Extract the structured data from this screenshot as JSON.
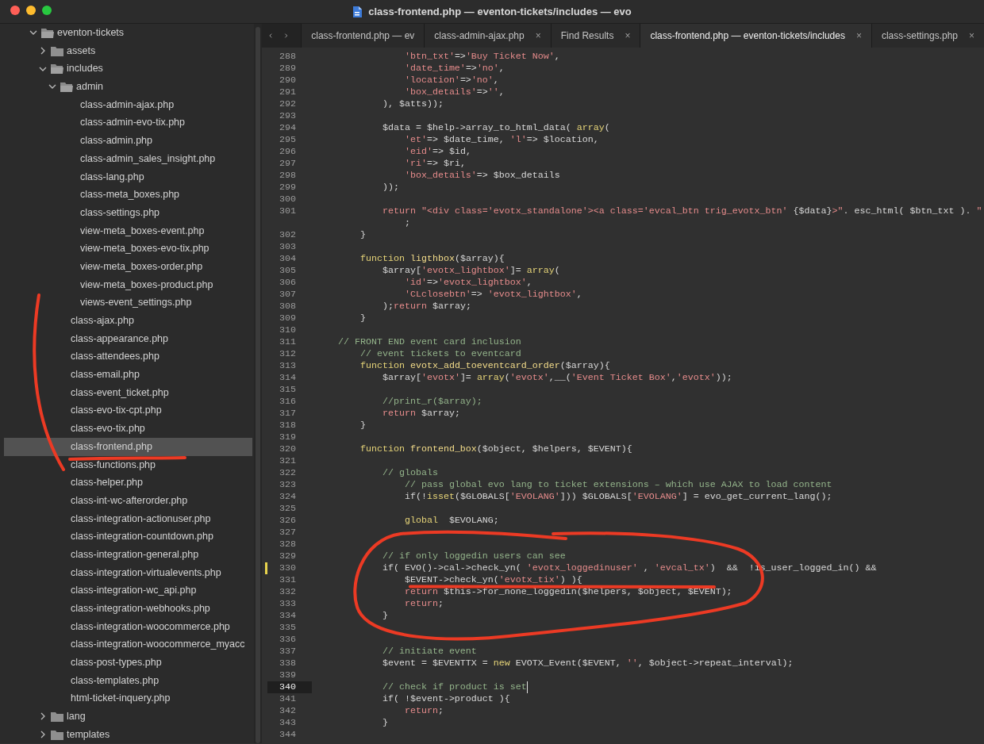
{
  "window": {
    "title": "class-frontend.php — eventon-tickets/includes — evo"
  },
  "sidebar": {
    "items": [
      {
        "name": "eventon-tickets",
        "kind": "folder",
        "expanded": true,
        "selected": false,
        "children": [
          {
            "name": "assets",
            "kind": "folder",
            "expanded": false,
            "selected": false
          },
          {
            "name": "includes",
            "kind": "folder",
            "expanded": true,
            "selected": false,
            "children": [
              {
                "name": "admin",
                "kind": "folder",
                "expanded": true,
                "selected": false,
                "children": [
                  {
                    "name": "class-admin-ajax.php",
                    "kind": "file",
                    "selected": false
                  },
                  {
                    "name": "class-admin-evo-tix.php",
                    "kind": "file",
                    "selected": false
                  },
                  {
                    "name": "class-admin.php",
                    "kind": "file",
                    "selected": false
                  },
                  {
                    "name": "class-admin_sales_insight.php",
                    "kind": "file",
                    "selected": false
                  },
                  {
                    "name": "class-lang.php",
                    "kind": "file",
                    "selected": false
                  },
                  {
                    "name": "class-meta_boxes.php",
                    "kind": "file",
                    "selected": false
                  },
                  {
                    "name": "class-settings.php",
                    "kind": "file",
                    "selected": false
                  },
                  {
                    "name": "view-meta_boxes-event.php",
                    "kind": "file",
                    "selected": false
                  },
                  {
                    "name": "view-meta_boxes-evo-tix.php",
                    "kind": "file",
                    "selected": false
                  },
                  {
                    "name": "view-meta_boxes-order.php",
                    "kind": "file",
                    "selected": false
                  },
                  {
                    "name": "view-meta_boxes-product.php",
                    "kind": "file",
                    "selected": false
                  },
                  {
                    "name": "views-event_settings.php",
                    "kind": "file",
                    "selected": false
                  }
                ]
              },
              {
                "name": "class-ajax.php",
                "kind": "file",
                "selected": false
              },
              {
                "name": "class-appearance.php",
                "kind": "file",
                "selected": false
              },
              {
                "name": "class-attendees.php",
                "kind": "file",
                "selected": false
              },
              {
                "name": "class-email.php",
                "kind": "file",
                "selected": false
              },
              {
                "name": "class-event_ticket.php",
                "kind": "file",
                "selected": false
              },
              {
                "name": "class-evo-tix-cpt.php",
                "kind": "file",
                "selected": false
              },
              {
                "name": "class-evo-tix.php",
                "kind": "file",
                "selected": false
              },
              {
                "name": "class-frontend.php",
                "kind": "file",
                "selected": true
              },
              {
                "name": "class-functions.php",
                "kind": "file",
                "selected": false
              },
              {
                "name": "class-helper.php",
                "kind": "file",
                "selected": false
              },
              {
                "name": "class-int-wc-afterorder.php",
                "kind": "file",
                "selected": false
              },
              {
                "name": "class-integration-actionuser.php",
                "kind": "file",
                "selected": false
              },
              {
                "name": "class-integration-countdown.php",
                "kind": "file",
                "selected": false
              },
              {
                "name": "class-integration-general.php",
                "kind": "file",
                "selected": false
              },
              {
                "name": "class-integration-virtualevents.php",
                "kind": "file",
                "selected": false
              },
              {
                "name": "class-integration-wc_api.php",
                "kind": "file",
                "selected": false
              },
              {
                "name": "class-integration-webhooks.php",
                "kind": "file",
                "selected": false
              },
              {
                "name": "class-integration-woocommerce.php",
                "kind": "file",
                "selected": false
              },
              {
                "name": "class-integration-woocommerce_myacc",
                "kind": "file",
                "selected": false
              },
              {
                "name": "class-post-types.php",
                "kind": "file",
                "selected": false
              },
              {
                "name": "class-templates.php",
                "kind": "file",
                "selected": false
              },
              {
                "name": "html-ticket-inquery.php",
                "kind": "file",
                "selected": false
              }
            ]
          },
          {
            "name": "lang",
            "kind": "folder",
            "expanded": false,
            "selected": false
          },
          {
            "name": "templates",
            "kind": "folder",
            "expanded": false,
            "selected": false
          }
        ]
      }
    ]
  },
  "tabs": [
    {
      "label": "class-frontend.php — ev",
      "selected": false
    },
    {
      "label": "class-admin-ajax.php",
      "selected": false,
      "close": "×"
    },
    {
      "label": "Find Results",
      "selected": false,
      "close": "×"
    },
    {
      "label": "class-frontend.php — eventon-tickets/includes",
      "selected": true,
      "close": "×"
    },
    {
      "label": "class-settings.php",
      "selected": false,
      "close": "×"
    }
  ],
  "editor": {
    "lines": [
      {
        "num": "288",
        "modified": false,
        "current": false,
        "parts": [
          {
            "kind": "str",
            "text": "                'btn_txt'"
          },
          {
            "kind": "plain",
            "text": "=>"
          },
          {
            "kind": "str",
            "text": "'Buy Ticket Now'"
          },
          {
            "kind": "plain",
            "text": ","
          }
        ]
      },
      {
        "num": "289",
        "modified": false,
        "current": false,
        "parts": [
          {
            "kind": "str",
            "text": "                'date_time'"
          },
          {
            "kind": "plain",
            "text": "=>"
          },
          {
            "kind": "str",
            "text": "'no'"
          },
          {
            "kind": "plain",
            "text": ","
          }
        ]
      },
      {
        "num": "290",
        "modified": false,
        "current": false,
        "parts": [
          {
            "kind": "str",
            "text": "                'location'"
          },
          {
            "kind": "plain",
            "text": "=>"
          },
          {
            "kind": "str",
            "text": "'no'"
          },
          {
            "kind": "plain",
            "text": ","
          }
        ]
      },
      {
        "num": "291",
        "modified": false,
        "current": false,
        "parts": [
          {
            "kind": "str",
            "text": "                'box_details'"
          },
          {
            "kind": "plain",
            "text": "=>"
          },
          {
            "kind": "str",
            "text": "''"
          },
          {
            "kind": "plain",
            "text": ","
          }
        ]
      },
      {
        "num": "292",
        "modified": false,
        "current": false,
        "parts": [
          {
            "kind": "plain",
            "text": "            ), $atts));"
          }
        ]
      },
      {
        "num": "293",
        "modified": false,
        "current": false
      },
      {
        "num": "294",
        "modified": false,
        "current": false,
        "parts": [
          {
            "kind": "plain",
            "text": "            $data = $help->array_to_html_data( "
          },
          {
            "kind": "kw",
            "text": "array"
          },
          {
            "kind": "plain",
            "text": "("
          }
        ]
      },
      {
        "num": "295",
        "modified": false,
        "current": false,
        "parts": [
          {
            "kind": "str",
            "text": "                'et'"
          },
          {
            "kind": "plain",
            "text": "=> $date_time, "
          },
          {
            "kind": "str",
            "text": "'l'"
          },
          {
            "kind": "plain",
            "text": "=> $location,"
          }
        ]
      },
      {
        "num": "296",
        "modified": false,
        "current": false,
        "parts": [
          {
            "kind": "str",
            "text": "                'eid'"
          },
          {
            "kind": "plain",
            "text": "=> $id,"
          }
        ]
      },
      {
        "num": "297",
        "modified": false,
        "current": false,
        "parts": [
          {
            "kind": "str",
            "text": "                'ri'"
          },
          {
            "kind": "plain",
            "text": "=> $ri,"
          }
        ]
      },
      {
        "num": "298",
        "modified": false,
        "current": false,
        "parts": [
          {
            "kind": "str",
            "text": "                'box_details'"
          },
          {
            "kind": "plain",
            "text": "=> $box_details"
          }
        ]
      },
      {
        "num": "299",
        "modified": false,
        "current": false,
        "parts": [
          {
            "kind": "plain",
            "text": "            ));"
          }
        ]
      },
      {
        "num": "300",
        "modified": false,
        "current": false
      },
      {
        "num": "301",
        "modified": false,
        "current": false,
        "parts": [
          {
            "kind": "ret",
            "text": "            return"
          },
          {
            "kind": "str",
            "text": " \"<div class='evotx_standalone'><a class='evcal_btn trig_evotx_btn' "
          },
          {
            "kind": "plain",
            "text": "{$data}"
          },
          {
            "kind": "str",
            "text": ">\""
          },
          {
            "kind": "plain",
            "text": ". esc_html( $btn_txt ). "
          },
          {
            "kind": "str",
            "text": "\""
          }
        ]
      },
      {
        "modified": false,
        "current": false,
        "parts": [
          {
            "kind": "plain",
            "text": "                ;"
          }
        ]
      },
      {
        "num": "302",
        "modified": false,
        "current": false,
        "parts": [
          {
            "kind": "plain",
            "text": "        }"
          }
        ]
      },
      {
        "num": "303",
        "modified": false,
        "current": false
      },
      {
        "num": "304",
        "modified": false,
        "current": false,
        "parts": [
          {
            "kind": "kw",
            "text": "        function"
          },
          {
            "kind": "ent",
            "text": " ligthbox"
          },
          {
            "kind": "plain",
            "text": "($array){"
          }
        ]
      },
      {
        "num": "305",
        "modified": false,
        "current": false,
        "parts": [
          {
            "kind": "plain",
            "text": "            $array["
          },
          {
            "kind": "str",
            "text": "'evotx_lightbox'"
          },
          {
            "kind": "plain",
            "text": "]= "
          },
          {
            "kind": "kw",
            "text": "array"
          },
          {
            "kind": "plain",
            "text": "("
          }
        ]
      },
      {
        "num": "306",
        "modified": false,
        "current": false,
        "parts": [
          {
            "kind": "str",
            "text": "                'id'"
          },
          {
            "kind": "plain",
            "text": "=>"
          },
          {
            "kind": "str",
            "text": "'evotx_lightbox'"
          },
          {
            "kind": "plain",
            "text": ","
          }
        ]
      },
      {
        "num": "307",
        "modified": false,
        "current": false,
        "parts": [
          {
            "kind": "str",
            "text": "                'CLclosebtn'"
          },
          {
            "kind": "plain",
            "text": "=> "
          },
          {
            "kind": "str",
            "text": "'evotx_lightbox'"
          },
          {
            "kind": "plain",
            "text": ","
          }
        ]
      },
      {
        "num": "308",
        "modified": false,
        "current": false,
        "parts": [
          {
            "kind": "plain",
            "text": "            );"
          },
          {
            "kind": "ret",
            "text": "return"
          },
          {
            "kind": "plain",
            "text": " $array;"
          }
        ]
      },
      {
        "num": "309",
        "modified": false,
        "current": false,
        "parts": [
          {
            "kind": "plain",
            "text": "        }"
          }
        ]
      },
      {
        "num": "310",
        "modified": false,
        "current": false
      },
      {
        "num": "311",
        "modified": false,
        "current": false,
        "parts": [
          {
            "kind": "cmt",
            "text": "    // FRONT END event card inclusion"
          }
        ]
      },
      {
        "num": "312",
        "modified": false,
        "current": false,
        "parts": [
          {
            "kind": "cmt",
            "text": "        // event tickets to eventcard"
          }
        ]
      },
      {
        "num": "313",
        "modified": false,
        "current": false,
        "parts": [
          {
            "kind": "kw",
            "text": "        function"
          },
          {
            "kind": "ent",
            "text": " evotx_add_toeventcard_order"
          },
          {
            "kind": "plain",
            "text": "($array){"
          }
        ]
      },
      {
        "num": "314",
        "modified": false,
        "current": false,
        "parts": [
          {
            "kind": "plain",
            "text": "            $array["
          },
          {
            "kind": "str",
            "text": "'evotx'"
          },
          {
            "kind": "plain",
            "text": "]= "
          },
          {
            "kind": "kw",
            "text": "array"
          },
          {
            "kind": "plain",
            "text": "("
          },
          {
            "kind": "str",
            "text": "'evotx'"
          },
          {
            "kind": "plain",
            "text": ",__("
          },
          {
            "kind": "str",
            "text": "'Event Ticket Box'"
          },
          {
            "kind": "plain",
            "text": ","
          },
          {
            "kind": "str",
            "text": "'evotx'"
          },
          {
            "kind": "plain",
            "text": "));"
          }
        ]
      },
      {
        "num": "315",
        "modified": false,
        "current": false
      },
      {
        "num": "316",
        "modified": false,
        "current": false,
        "parts": [
          {
            "kind": "cmt",
            "text": "            //print_r($array);"
          }
        ]
      },
      {
        "num": "317",
        "modified": false,
        "current": false,
        "parts": [
          {
            "kind": "ret",
            "text": "            return"
          },
          {
            "kind": "plain",
            "text": " $array;"
          }
        ]
      },
      {
        "num": "318",
        "modified": false,
        "current": false,
        "parts": [
          {
            "kind": "plain",
            "text": "        }"
          }
        ]
      },
      {
        "num": "319",
        "modified": false,
        "current": false
      },
      {
        "num": "320",
        "modified": false,
        "current": false,
        "parts": [
          {
            "kind": "kw",
            "text": "        function"
          },
          {
            "kind": "ent",
            "text": " frontend_box"
          },
          {
            "kind": "plain",
            "text": "($object, $helpers, $EVENT){"
          }
        ]
      },
      {
        "num": "321",
        "modified": false,
        "current": false
      },
      {
        "num": "322",
        "modified": false,
        "current": false,
        "parts": [
          {
            "kind": "cmt",
            "text": "            // globals"
          }
        ]
      },
      {
        "num": "323",
        "modified": false,
        "current": false,
        "parts": [
          {
            "kind": "cmt",
            "text": "                // pass global evo lang to ticket extensions – which use AJAX to load content"
          }
        ]
      },
      {
        "num": "324",
        "modified": false,
        "current": false,
        "parts": [
          {
            "kind": "plain",
            "text": "                if(!"
          },
          {
            "kind": "kw",
            "text": "isset"
          },
          {
            "kind": "plain",
            "text": "($GLOBALS["
          },
          {
            "kind": "str",
            "text": "'EVOLANG'"
          },
          {
            "kind": "plain",
            "text": "])) $GLOBALS["
          },
          {
            "kind": "str",
            "text": "'EVOLANG'"
          },
          {
            "kind": "plain",
            "text": "] = evo_get_current_lang();"
          }
        ]
      },
      {
        "num": "325",
        "modified": false,
        "current": false
      },
      {
        "num": "326",
        "modified": false,
        "current": false,
        "parts": [
          {
            "kind": "kw",
            "text": "                global"
          },
          {
            "kind": "plain",
            "text": "  $EVOLANG;"
          }
        ]
      },
      {
        "num": "327",
        "modified": false,
        "current": false
      },
      {
        "num": "328",
        "modified": false,
        "current": false
      },
      {
        "num": "329",
        "modified": false,
        "current": false,
        "parts": [
          {
            "kind": "cmt",
            "text": "            // if only loggedin users can see"
          }
        ]
      },
      {
        "num": "330",
        "modified": true,
        "current": false,
        "parts": [
          {
            "kind": "plain",
            "text": "            if( EVO()->cal->check_yn( "
          },
          {
            "kind": "str",
            "text": "'evotx_loggedinuser'"
          },
          {
            "kind": "plain",
            "text": " , "
          },
          {
            "kind": "str",
            "text": "'evcal_tx'"
          },
          {
            "kind": "plain",
            "text": ")  &&  !is_user_logged_in() &&"
          }
        ]
      },
      {
        "num": "331",
        "modified": false,
        "current": false,
        "parts": [
          {
            "kind": "plain",
            "text": "                $EVENT->check_yn("
          },
          {
            "kind": "str",
            "text": "'evotx_tix'"
          },
          {
            "kind": "plain",
            "text": ") ){"
          }
        ]
      },
      {
        "num": "332",
        "modified": false,
        "current": false,
        "parts": [
          {
            "kind": "ret",
            "text": "                return"
          },
          {
            "kind": "plain",
            "text": " $this->for_none_loggedin($helpers, $object, $EVENT);"
          }
        ]
      },
      {
        "num": "333",
        "modified": false,
        "current": false,
        "parts": [
          {
            "kind": "ret",
            "text": "                return"
          },
          {
            "kind": "plain",
            "text": ";"
          }
        ]
      },
      {
        "num": "334",
        "modified": false,
        "current": false,
        "parts": [
          {
            "kind": "plain",
            "text": "            }"
          }
        ]
      },
      {
        "num": "335",
        "modified": false,
        "current": false
      },
      {
        "num": "336",
        "modified": false,
        "current": false
      },
      {
        "num": "337",
        "modified": false,
        "current": false,
        "parts": [
          {
            "kind": "cmt",
            "text": "            // initiate event"
          }
        ]
      },
      {
        "num": "338",
        "modified": false,
        "current": false,
        "parts": [
          {
            "kind": "plain",
            "text": "            $event = $EVENTTX = "
          },
          {
            "kind": "kw",
            "text": "new"
          },
          {
            "kind": "plain",
            "text": " EVOTX_Event($EVENT, "
          },
          {
            "kind": "str",
            "text": "''"
          },
          {
            "kind": "plain",
            "text": ", $object->repeat_interval);"
          }
        ]
      },
      {
        "num": "339",
        "modified": false,
        "current": false
      },
      {
        "num": "340",
        "modified": false,
        "current": true,
        "parts": [
          {
            "kind": "cmt",
            "text": "            // check if product is set"
          }
        ]
      },
      {
        "num": "341",
        "modified": false,
        "current": false,
        "parts": [
          {
            "kind": "plain",
            "text": "            if( !$event->product ){"
          }
        ]
      },
      {
        "num": "342",
        "modified": false,
        "current": false,
        "parts": [
          {
            "kind": "ret",
            "text": "                return"
          },
          {
            "kind": "plain",
            "text": ";"
          }
        ]
      },
      {
        "num": "343",
        "modified": false,
        "current": false,
        "parts": [
          {
            "kind": "plain",
            "text": "            }"
          }
        ]
      },
      {
        "num": "344",
        "modified": false,
        "current": false
      }
    ]
  },
  "annotations": [
    {
      "kind": "ellipse"
    },
    {
      "kind": "curve"
    },
    {
      "kind": "underline"
    }
  ]
}
